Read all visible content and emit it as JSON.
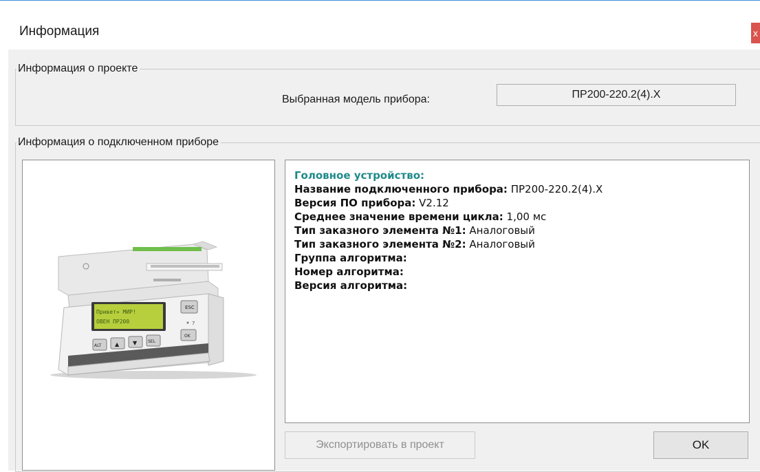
{
  "window": {
    "title": "Информация",
    "close_label": "x"
  },
  "project_group": {
    "legend": "Информация о проекте",
    "model_label": "Выбранная модель прибора:",
    "model_value": "ПР200-220.2(4).X"
  },
  "device_group": {
    "legend": "Информация о подключенном приборе",
    "image": {
      "lcd_line1": "Привет» МИР!",
      "lcd_line2": "ОВЕН ПР200",
      "buttons": [
        "ALT",
        "▲",
        "▼",
        "SEL",
        "ESC",
        "OK"
      ]
    },
    "info": {
      "heading": "Головное устройство:",
      "lines": [
        {
          "label": "Название подключенного прибора:",
          "value": "ПР200-220.2(4).X"
        },
        {
          "label": "Версия ПО прибора:",
          "value": "V2.12"
        },
        {
          "label": "Среднее значение времени цикла:",
          "value": "1,00 мс"
        },
        {
          "label": "Тип заказного элемента №1:",
          "value": "Аналоговый"
        },
        {
          "label": "Тип заказного элемента №2:",
          "value": "Аналоговый"
        },
        {
          "label": "Группа алгоритма:",
          "value": ""
        },
        {
          "label": "Номер алгоритма:",
          "value": ""
        },
        {
          "label": "Версия алгоритма:",
          "value": ""
        }
      ]
    }
  },
  "buttons": {
    "export_label": "Экспортировать в проект",
    "ok_label": "OK"
  }
}
